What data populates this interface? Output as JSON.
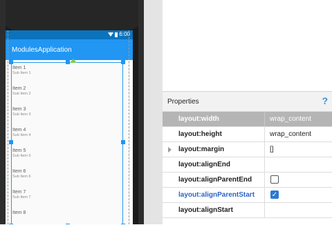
{
  "app": {
    "status_time": "6:00",
    "title": "ModulesApplication"
  },
  "list": [
    {
      "title": "Item 1",
      "sub": "Sub Item 1"
    },
    {
      "title": "Item 2",
      "sub": "Sub Item 2"
    },
    {
      "title": "Item 3",
      "sub": "Sub Item 3"
    },
    {
      "title": "Item 4",
      "sub": "Sub Item 4"
    },
    {
      "title": "Item 5",
      "sub": "Sub Item 5"
    },
    {
      "title": "Item 6",
      "sub": "Sub Item 6"
    },
    {
      "title": "Item 7",
      "sub": "Sub Item 7"
    },
    {
      "title": "Item 8",
      "sub": ""
    }
  ],
  "properties": {
    "title": "Properties",
    "help": "?",
    "rows": [
      {
        "name": "layout:width",
        "value": "wrap_content"
      },
      {
        "name": "layout:height",
        "value": "wrap_content"
      },
      {
        "name": "layout:margin",
        "value": "[]"
      },
      {
        "name": "layout:alignEnd",
        "value": ""
      },
      {
        "name": "layout:alignParentEnd",
        "checked": false
      },
      {
        "name": "layout:alignParentStart",
        "checked": true
      },
      {
        "name": "layout:alignStart",
        "value": ""
      }
    ]
  },
  "colors": {
    "app_bar": "#2196f3",
    "status_bar": "#0b73bd",
    "selection": "#2196f3",
    "selected_row": "#b5b5b5",
    "highlight_text": "#2f63c5"
  },
  "icons": [
    "wifi-icon",
    "battery-icon",
    "anchor-icon",
    "help-icon",
    "expand-arrow-icon",
    "checkbox-icon"
  ]
}
